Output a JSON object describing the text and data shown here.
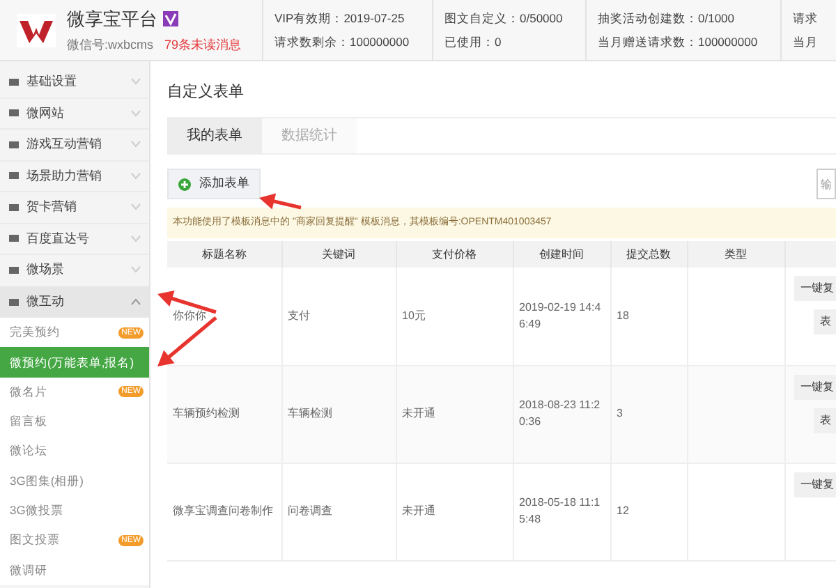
{
  "header": {
    "title": "微享宝平台",
    "account": "微信号:wxbcms",
    "unread": "79条未读消息",
    "stats": [
      {
        "lines": [
          "VIP有效期：2019-07-25",
          "请求数剩余：100000000"
        ]
      },
      {
        "lines": [
          "图文自定义：0/50000",
          "已使用：0"
        ]
      },
      {
        "lines": [
          "抽奖活动创建数：0/1000",
          "当月赠送请求数：100000000"
        ]
      },
      {
        "lines": [
          "请求",
          "当月"
        ]
      }
    ]
  },
  "sidebar": {
    "items": [
      {
        "label": "基础设置",
        "expanded": false
      },
      {
        "label": "微网站",
        "expanded": false
      },
      {
        "label": "游戏互动营销",
        "expanded": false
      },
      {
        "label": "场景助力营销",
        "expanded": false
      },
      {
        "label": "贺卡营销",
        "expanded": false
      },
      {
        "label": "百度直达号",
        "expanded": false
      },
      {
        "label": "微场景",
        "expanded": false
      },
      {
        "label": "微互动",
        "expanded": true,
        "children": [
          {
            "label": "完美预约",
            "badge": "NEW",
            "selected": false
          },
          {
            "label": "微预约(万能表单,报名)",
            "selected": true
          },
          {
            "label": "微名片",
            "badge": "NEW",
            "selected": false
          },
          {
            "label": "留言板",
            "selected": false
          },
          {
            "label": "微论坛",
            "selected": false
          },
          {
            "label": "3G图集(相册)",
            "selected": false
          },
          {
            "label": "3G微投票",
            "selected": false
          },
          {
            "label": "图文投票",
            "badge": "NEW",
            "selected": false
          },
          {
            "label": "微调研",
            "selected": false
          }
        ]
      }
    ]
  },
  "page_title": "自定义表单",
  "tabs": [
    {
      "label": "我的表单",
      "selected": true
    },
    {
      "label": "数据统计",
      "selected": false
    }
  ],
  "add_button": "添加表单",
  "search": {
    "placeholder": "输"
  },
  "notice": "本功能使用了模板消息中的 \"商家回复提醒\" 模板消息，其模板编号:OPENTM401003457",
  "table": {
    "columns": [
      "标题名称",
      "关键词",
      "支付价格",
      "创建时间",
      "提交总数",
      "类型",
      ""
    ],
    "rows": [
      {
        "cells": [
          "你你你",
          "支付",
          "10元",
          "2019-02-19 14:46:49",
          "18",
          ""
        ],
        "actions": [
          "一键复",
          "表"
        ]
      },
      {
        "cells": [
          "车辆预约检测",
          "车辆检测",
          "未开通",
          "2018-08-23 11:20:36",
          "3",
          ""
        ],
        "actions": [
          "一键复",
          "表"
        ]
      },
      {
        "cells": [
          "微享宝调查问卷制作",
          "问卷调查",
          "未开通",
          "2018-05-18 11:15:48",
          "12",
          ""
        ],
        "actions": [
          "一键复"
        ]
      }
    ]
  }
}
